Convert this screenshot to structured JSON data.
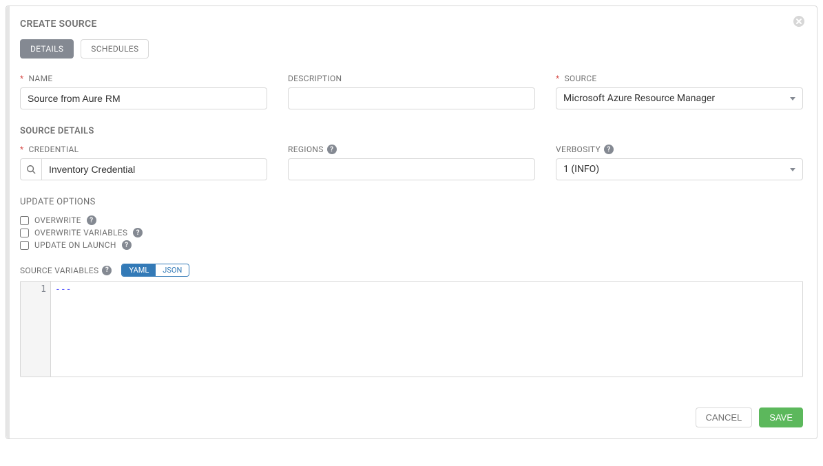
{
  "header": {
    "title": "CREATE SOURCE"
  },
  "tabs": {
    "details": "DETAILS",
    "schedules": "SCHEDULES",
    "active": "details"
  },
  "fields": {
    "name": {
      "label": "NAME",
      "value": "Source from Aure RM",
      "required": true
    },
    "description": {
      "label": "DESCRIPTION",
      "value": ""
    },
    "source": {
      "label": "SOURCE",
      "value": "Microsoft Azure Resource Manager",
      "required": true
    }
  },
  "section_source_details": "SOURCE DETAILS",
  "credential": {
    "label": "CREDENTIAL",
    "value": "Inventory Credential",
    "required": true
  },
  "regions": {
    "label": "REGIONS",
    "value": ""
  },
  "verbosity": {
    "label": "VERBOSITY",
    "value": "1 (INFO)"
  },
  "update_options": {
    "label": "UPDATE OPTIONS",
    "overwrite": {
      "label": "OVERWRITE",
      "checked": false
    },
    "overwrite_vars": {
      "label": "OVERWRITE VARIABLES",
      "checked": false
    },
    "update_launch": {
      "label": "UPDATE ON LAUNCH",
      "checked": false
    }
  },
  "source_vars": {
    "label": "SOURCE VARIABLES",
    "yaml_btn": "YAML",
    "json_btn": "JSON",
    "active": "yaml",
    "line_number": "1",
    "content": "---"
  },
  "footer": {
    "cancel": "CANCEL",
    "save": "SAVE"
  }
}
